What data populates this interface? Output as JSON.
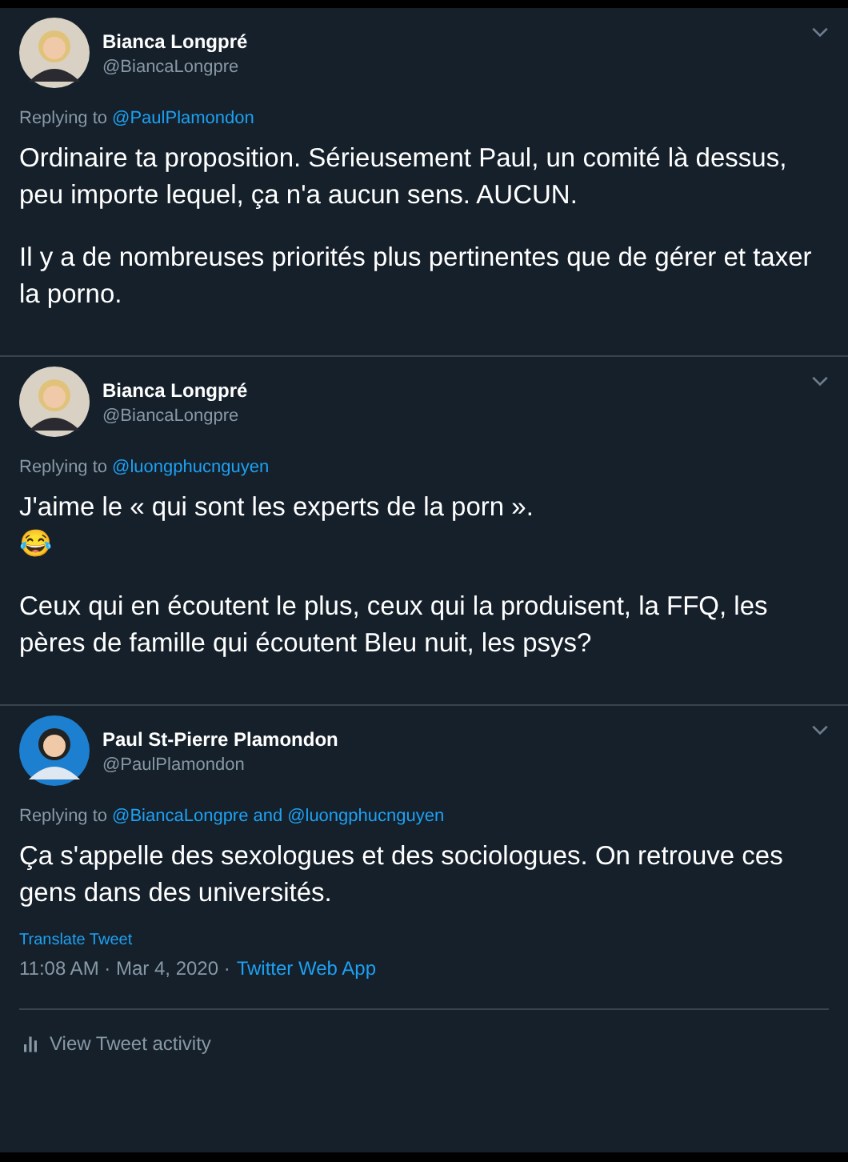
{
  "tweets": [
    {
      "name": "Bianca Longpré",
      "handle": "@BiancaLongpre",
      "replying_label": "Replying to",
      "replying_to": [
        "@PaulPlamondon"
      ],
      "paragraphs": [
        "Ordinaire ta proposition. Sérieusement Paul, un comité là dessus, peu importe lequel, ça n'a aucun sens. AUCUN.",
        "Il y a de nombreuses priorités plus pertinentes que de gérer et taxer la porno."
      ]
    },
    {
      "name": "Bianca Longpré",
      "handle": "@BiancaLongpre",
      "replying_label": "Replying to",
      "replying_to": [
        "@luongphucnguyen"
      ],
      "paragraphs": [
        "J'aime le « qui sont les experts de la porn ».\n😂",
        "Ceux qui en écoutent le plus, ceux qui la produisent, la FFQ, les pères de famille qui écoutent Bleu nuit, les psys?"
      ]
    },
    {
      "name": "Paul St-Pierre Plamondon",
      "handle": "@PaulPlamondon",
      "replying_label": "Replying to",
      "replying_to": [
        "@BiancaLongpre",
        "@luongphucnguyen"
      ],
      "joiner": "and",
      "paragraphs": [
        "Ça s'appelle des sexologues et des sociologues. On retrouve ces gens dans des universités."
      ],
      "translate": "Translate Tweet",
      "time": "11:08 AM · Mar 4, 2020 ·",
      "source": "Twitter Web App",
      "activity": "View Tweet activity"
    }
  ]
}
